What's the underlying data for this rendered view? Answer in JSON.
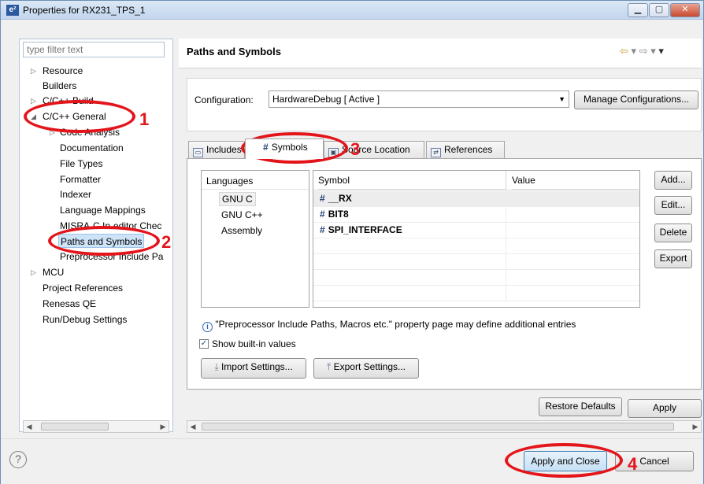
{
  "window": {
    "title": "Properties for RX231_TPS_1",
    "app_icon_text": "e²",
    "min_glyph": "▁",
    "max_glyph": "▢",
    "close_glyph": "✕"
  },
  "filter": {
    "placeholder": "type filter text"
  },
  "tree": {
    "items": [
      {
        "label": "Resource"
      },
      {
        "label": "Builders"
      },
      {
        "label": "C/C++ Build"
      },
      {
        "label": "C/C++ General"
      },
      {
        "label": "Code Analysis"
      },
      {
        "label": "Documentation"
      },
      {
        "label": "File Types"
      },
      {
        "label": "Formatter"
      },
      {
        "label": "Indexer"
      },
      {
        "label": "Language Mappings"
      },
      {
        "label": "MISRA-C In-editor Chec"
      },
      {
        "label": "Paths and Symbols"
      },
      {
        "label": "Preprocessor Include Pa"
      },
      {
        "label": "MCU"
      },
      {
        "label": "Project References"
      },
      {
        "label": "Renesas QE"
      },
      {
        "label": "Run/Debug Settings"
      }
    ]
  },
  "page": {
    "title": "Paths and Symbols"
  },
  "configuration": {
    "label": "Configuration:",
    "value": "HardwareDebug  [ Active ]",
    "manage_button": "Manage Configurations..."
  },
  "tabs": [
    {
      "label": "Includes"
    },
    {
      "label": "Symbols"
    },
    {
      "label": "Source Location"
    },
    {
      "label": "References"
    }
  ],
  "languages": {
    "header": "Languages",
    "items": [
      "GNU C",
      "GNU C++",
      "Assembly"
    ]
  },
  "symbols": {
    "col_symbol": "Symbol",
    "col_value": "Value",
    "rows": [
      {
        "name": "__RX",
        "value": ""
      },
      {
        "name": "BIT8",
        "value": ""
      },
      {
        "name": "SPI_INTERFACE",
        "value": ""
      }
    ]
  },
  "side_buttons": [
    "Add...",
    "Edit...",
    "Delete",
    "Export"
  ],
  "info_text": "\"Preprocessor Include Paths, Macros etc.\" property page may define additional entries",
  "show_builtin": {
    "label": "Show built-in values",
    "checked": true
  },
  "import_button": "Import Settings...",
  "export_button": "Export Settings...",
  "restore_defaults": "Restore Defaults",
  "apply": "Apply",
  "apply_close": "Apply and Close",
  "cancel": "Cancel",
  "help_glyph": "?",
  "annotations": [
    "1",
    "2",
    "3",
    "4"
  ],
  "colors": {
    "annotation": "#e4141b",
    "selection": "#cde3f7",
    "accent": "#2c5aa0"
  }
}
